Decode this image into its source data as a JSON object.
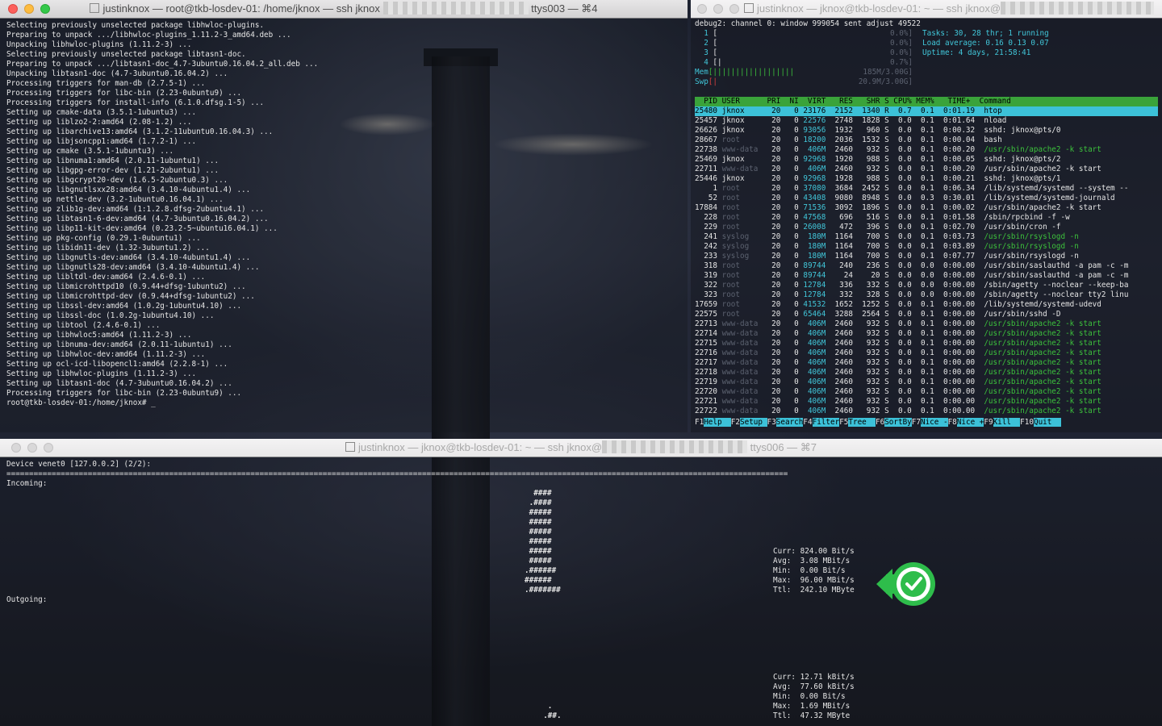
{
  "win1": {
    "title": "justinknox — root@tkb-losdev-01: /home/jknox — ssh jknox",
    "title_tail": "ttys003 — ⌘4",
    "lines": [
      "Selecting previously unselected package libhwloc-plugins.",
      "Preparing to unpack .../libhwloc-plugins_1.11.2-3_amd64.deb ...",
      "Unpacking libhwloc-plugins (1.11.2-3) ...",
      "Selecting previously unselected package libtasn1-doc.",
      "Preparing to unpack .../libtasn1-doc_4.7-3ubuntu0.16.04.2_all.deb ...",
      "Unpacking libtasn1-doc (4.7-3ubuntu0.16.04.2) ...",
      "Processing triggers for man-db (2.7.5-1) ...",
      "Processing triggers for libc-bin (2.23-0ubuntu9) ...",
      "Processing triggers for install-info (6.1.0.dfsg.1-5) ...",
      "Setting up cmake-data (3.5.1-1ubuntu3) ...",
      "Setting up liblzo2-2:amd64 (2.08-1.2) ...",
      "Setting up libarchive13:amd64 (3.1.2-11ubuntu0.16.04.3) ...",
      "Setting up libjsoncpp1:amd64 (1.7.2-1) ...",
      "Setting up cmake (3.5.1-1ubuntu3) ...",
      "Setting up libnuma1:amd64 (2.0.11-1ubuntu1) ...",
      "Setting up libgpg-error-dev (1.21-2ubuntu1) ...",
      "Setting up libgcrypt20-dev (1.6.5-2ubuntu0.3) ...",
      "Setting up libgnutlsxx28:amd64 (3.4.10-4ubuntu1.4) ...",
      "Setting up nettle-dev (3.2-1ubuntu0.16.04.1) ...",
      "Setting up zlib1g-dev:amd64 (1:1.2.8.dfsg-2ubuntu4.1) ...",
      "Setting up libtasn1-6-dev:amd64 (4.7-3ubuntu0.16.04.2) ...",
      "Setting up libp11-kit-dev:amd64 (0.23.2-5~ubuntu16.04.1) ...",
      "Setting up pkg-config (0.29.1-0ubuntu1) ...",
      "Setting up libidn11-dev (1.32-3ubuntu1.2) ...",
      "Setting up libgnutls-dev:amd64 (3.4.10-4ubuntu1.4) ...",
      "Setting up libgnutls28-dev:amd64 (3.4.10-4ubuntu1.4) ...",
      "Setting up libltdl-dev:amd64 (2.4.6-0.1) ...",
      "Setting up libmicrohttpd10 (0.9.44+dfsg-1ubuntu2) ...",
      "Setting up libmicrohttpd-dev (0.9.44+dfsg-1ubuntu2) ...",
      "Setting up libssl-dev:amd64 (1.0.2g-1ubuntu4.10) ...",
      "Setting up libssl-doc (1.0.2g-1ubuntu4.10) ...",
      "Setting up libtool (2.4.6-0.1) ...",
      "Setting up libhwloc5:amd64 (1.11.2-3) ...",
      "Setting up libnuma-dev:amd64 (2.0.11-1ubuntu1) ...",
      "Setting up libhwloc-dev:amd64 (1.11.2-3) ...",
      "Setting up ocl-icd-libopencl1:amd64 (2.2.8-1) ...",
      "Setting up libhwloc-plugins (1.11.2-3) ...",
      "Setting up libtasn1-doc (4.7-3ubuntu0.16.04.2) ...",
      "Processing triggers for libc-bin (2.23-0ubuntu9) ...",
      "root@tkb-losdev-01:/home/jknox# _"
    ]
  },
  "win2": {
    "title": "justinknox — jknox@tkb-losdev-01: ~ — ssh jknox@",
    "debug": "debug2: channel 0: window 999054 sent adjust 49522",
    "meters": [
      {
        "label": "1",
        "bar": "[",
        "val": "0.0%]"
      },
      {
        "label": "2",
        "bar": "[",
        "val": "0.0%]"
      },
      {
        "label": "3",
        "bar": "[",
        "val": "0.0%]"
      },
      {
        "label": "4",
        "bar": "[|",
        "val": "0.7%]"
      },
      {
        "label": "Mem",
        "bar": "[||||||||||||||||||",
        "val": "185M/3.00G]"
      },
      {
        "label": "Swp",
        "bar": "[|",
        "val": "20.9M/3.00G]"
      }
    ],
    "summary": [
      {
        "k": "Tasks: ",
        "v": "30, 28 thr; 1 running"
      },
      {
        "k": "Load average: ",
        "v": "0.16 0.13 0.07"
      },
      {
        "k": "Uptime: ",
        "v": "4 days, 21:58:41"
      }
    ],
    "header": "  PID USER      PRI  NI  VIRT   RES   SHR S CPU% MEM%   TIME+  Command",
    "procs": [
      {
        "pid": "25480",
        "user": "jknox",
        "virt": "23176",
        "res": "2152",
        "shr": "1340",
        "s": "R",
        "cpu": "0.7",
        "mem": "0.1",
        "time": "0:01.19",
        "cmd": "htop",
        "hl": true
      },
      {
        "pid": "25457",
        "user": "jknox",
        "virt": "22576",
        "res": "2748",
        "shr": "1828",
        "s": "S",
        "cpu": "0.0",
        "mem": "0.1",
        "time": "0:01.64",
        "cmd": "nload"
      },
      {
        "pid": "26626",
        "user": "jknox",
        "virt": "93056",
        "res": "1932",
        "shr": "960",
        "s": "S",
        "cpu": "0.0",
        "mem": "0.1",
        "time": "0:00.32",
        "cmd": "sshd: jknox@pts/0"
      },
      {
        "pid": "28667",
        "user": "root",
        "virt": "18200",
        "res": "2036",
        "shr": "1532",
        "s": "S",
        "cpu": "0.0",
        "mem": "0.1",
        "time": "0:00.04",
        "cmd": "bash"
      },
      {
        "pid": "22738",
        "user": "www-data",
        "virt": "406M",
        "res": "2460",
        "shr": "932",
        "s": "S",
        "cpu": "0.0",
        "mem": "0.1",
        "time": "0:00.20",
        "cmd": "/usr/sbin/apache2 -k start",
        "green": true
      },
      {
        "pid": "25469",
        "user": "jknox",
        "virt": "92968",
        "res": "1920",
        "shr": "988",
        "s": "S",
        "cpu": "0.0",
        "mem": "0.1",
        "time": "0:00.05",
        "cmd": "sshd: jknox@pts/2"
      },
      {
        "pid": "22711",
        "user": "www-data",
        "virt": "406M",
        "res": "2460",
        "shr": "932",
        "s": "S",
        "cpu": "0.0",
        "mem": "0.1",
        "time": "0:00.20",
        "cmd": "/usr/sbin/apache2 -k start"
      },
      {
        "pid": "25446",
        "user": "jknox",
        "virt": "92968",
        "res": "1928",
        "shr": "988",
        "s": "S",
        "cpu": "0.0",
        "mem": "0.1",
        "time": "0:00.21",
        "cmd": "sshd: jknox@pts/1"
      },
      {
        "pid": "1",
        "user": "root",
        "virt": "37080",
        "res": "3684",
        "shr": "2452",
        "s": "S",
        "cpu": "0.0",
        "mem": "0.1",
        "time": "0:06.34",
        "cmd": "/lib/systemd/systemd --system --"
      },
      {
        "pid": "52",
        "user": "root",
        "virt": "43408",
        "res": "9080",
        "shr": "8948",
        "s": "S",
        "cpu": "0.0",
        "mem": "0.3",
        "time": "0:30.01",
        "cmd": "/lib/systemd/systemd-journald"
      },
      {
        "pid": "17884",
        "user": "root",
        "virt": "71536",
        "res": "3092",
        "shr": "1896",
        "s": "S",
        "cpu": "0.0",
        "mem": "0.1",
        "time": "0:00.02",
        "cmd": "/usr/sbin/apache2 -k start"
      },
      {
        "pid": "228",
        "user": "root",
        "virt": "47568",
        "res": "696",
        "shr": "516",
        "s": "S",
        "cpu": "0.0",
        "mem": "0.1",
        "time": "0:01.58",
        "cmd": "/sbin/rpcbind -f -w"
      },
      {
        "pid": "229",
        "user": "root",
        "virt": "26008",
        "res": "472",
        "shr": "396",
        "s": "S",
        "cpu": "0.0",
        "mem": "0.1",
        "time": "0:02.70",
        "cmd": "/usr/sbin/cron -f"
      },
      {
        "pid": "241",
        "user": "syslog",
        "virt": "180M",
        "res": "1164",
        "shr": "700",
        "s": "S",
        "cpu": "0.0",
        "mem": "0.1",
        "time": "0:03.73",
        "cmd": "/usr/sbin/rsyslogd -n",
        "green": true
      },
      {
        "pid": "242",
        "user": "syslog",
        "virt": "180M",
        "res": "1164",
        "shr": "700",
        "s": "S",
        "cpu": "0.0",
        "mem": "0.1",
        "time": "0:03.89",
        "cmd": "/usr/sbin/rsyslogd -n",
        "green": true
      },
      {
        "pid": "233",
        "user": "syslog",
        "virt": "180M",
        "res": "1164",
        "shr": "700",
        "s": "S",
        "cpu": "0.0",
        "mem": "0.1",
        "time": "0:07.77",
        "cmd": "/usr/sbin/rsyslogd -n"
      },
      {
        "pid": "318",
        "user": "root",
        "virt": "89744",
        "res": "240",
        "shr": "236",
        "s": "S",
        "cpu": "0.0",
        "mem": "0.0",
        "time": "0:00.00",
        "cmd": "/usr/sbin/saslauthd -a pam -c -m"
      },
      {
        "pid": "319",
        "user": "root",
        "virt": "89744",
        "res": "24",
        "shr": "20",
        "s": "S",
        "cpu": "0.0",
        "mem": "0.0",
        "time": "0:00.00",
        "cmd": "/usr/sbin/saslauthd -a pam -c -m"
      },
      {
        "pid": "322",
        "user": "root",
        "virt": "12784",
        "res": "336",
        "shr": "332",
        "s": "S",
        "cpu": "0.0",
        "mem": "0.0",
        "time": "0:00.00",
        "cmd": "/sbin/agetty --noclear --keep-ba"
      },
      {
        "pid": "323",
        "user": "root",
        "virt": "12784",
        "res": "332",
        "shr": "328",
        "s": "S",
        "cpu": "0.0",
        "mem": "0.0",
        "time": "0:00.00",
        "cmd": "/sbin/agetty --noclear tty2 linu"
      },
      {
        "pid": "17659",
        "user": "root",
        "virt": "41532",
        "res": "1652",
        "shr": "1252",
        "s": "S",
        "cpu": "0.0",
        "mem": "0.1",
        "time": "0:00.00",
        "cmd": "/lib/systemd/systemd-udevd"
      },
      {
        "pid": "22575",
        "user": "root",
        "virt": "65464",
        "res": "3288",
        "shr": "2564",
        "s": "S",
        "cpu": "0.0",
        "mem": "0.1",
        "time": "0:00.00",
        "cmd": "/usr/sbin/sshd -D"
      },
      {
        "pid": "22713",
        "user": "www-data",
        "virt": "406M",
        "res": "2460",
        "shr": "932",
        "s": "S",
        "cpu": "0.0",
        "mem": "0.1",
        "time": "0:00.00",
        "cmd": "/usr/sbin/apache2 -k start",
        "green": true
      },
      {
        "pid": "22714",
        "user": "www-data",
        "virt": "406M",
        "res": "2460",
        "shr": "932",
        "s": "S",
        "cpu": "0.0",
        "mem": "0.1",
        "time": "0:00.00",
        "cmd": "/usr/sbin/apache2 -k start",
        "green": true
      },
      {
        "pid": "22715",
        "user": "www-data",
        "virt": "406M",
        "res": "2460",
        "shr": "932",
        "s": "S",
        "cpu": "0.0",
        "mem": "0.1",
        "time": "0:00.00",
        "cmd": "/usr/sbin/apache2 -k start",
        "green": true
      },
      {
        "pid": "22716",
        "user": "www-data",
        "virt": "406M",
        "res": "2460",
        "shr": "932",
        "s": "S",
        "cpu": "0.0",
        "mem": "0.1",
        "time": "0:00.00",
        "cmd": "/usr/sbin/apache2 -k start",
        "green": true
      },
      {
        "pid": "22717",
        "user": "www-data",
        "virt": "406M",
        "res": "2460",
        "shr": "932",
        "s": "S",
        "cpu": "0.0",
        "mem": "0.1",
        "time": "0:00.00",
        "cmd": "/usr/sbin/apache2 -k start",
        "green": true
      },
      {
        "pid": "22718",
        "user": "www-data",
        "virt": "406M",
        "res": "2460",
        "shr": "932",
        "s": "S",
        "cpu": "0.0",
        "mem": "0.1",
        "time": "0:00.00",
        "cmd": "/usr/sbin/apache2 -k start",
        "green": true
      },
      {
        "pid": "22719",
        "user": "www-data",
        "virt": "406M",
        "res": "2460",
        "shr": "932",
        "s": "S",
        "cpu": "0.0",
        "mem": "0.1",
        "time": "0:00.00",
        "cmd": "/usr/sbin/apache2 -k start",
        "green": true
      },
      {
        "pid": "22720",
        "user": "www-data",
        "virt": "406M",
        "res": "2460",
        "shr": "932",
        "s": "S",
        "cpu": "0.0",
        "mem": "0.1",
        "time": "0:00.00",
        "cmd": "/usr/sbin/apache2 -k start",
        "green": true
      },
      {
        "pid": "22721",
        "user": "www-data",
        "virt": "406M",
        "res": "2460",
        "shr": "932",
        "s": "S",
        "cpu": "0.0",
        "mem": "0.1",
        "time": "0:00.00",
        "cmd": "/usr/sbin/apache2 -k start",
        "green": true
      },
      {
        "pid": "22722",
        "user": "www-data",
        "virt": "406M",
        "res": "2460",
        "shr": "932",
        "s": "S",
        "cpu": "0.0",
        "mem": "0.1",
        "time": "0:00.00",
        "cmd": "/usr/sbin/apache2 -k start",
        "green": true
      }
    ],
    "fkeys": [
      {
        "k": "F1",
        "l": "Help  "
      },
      {
        "k": "F2",
        "l": "Setup "
      },
      {
        "k": "F3",
        "l": "Search"
      },
      {
        "k": "F4",
        "l": "Filter"
      },
      {
        "k": "F5",
        "l": "Tree  "
      },
      {
        "k": "F6",
        "l": "SortBy"
      },
      {
        "k": "F7",
        "l": "Nice -"
      },
      {
        "k": "F8",
        "l": "Nice +"
      },
      {
        "k": "F9",
        "l": "Kill  "
      },
      {
        "k": "F10",
        "l": "Quit  "
      }
    ]
  },
  "win3": {
    "title": "justinknox — jknox@tkb-losdev-01: ~ — ssh jknox@",
    "title_tail": "ttys006 — ⌘7",
    "device": "Device venet0 [127.0.0.2] (2/2):",
    "rule": "=============================================================================================================================================================================",
    "incoming_label": "Incoming:",
    "outgoing_label": "Outgoing:",
    "in_graph": [
      "  ####",
      " .####",
      " #####",
      " #####",
      " #####",
      " #####",
      " #####",
      " #####",
      ".######",
      "######",
      ".#######"
    ],
    "out_graph": [
      "   .",
      "  .##."
    ],
    "in_stats": [
      {
        "k": "Curr:",
        "v": "824.00 Bit/s"
      },
      {
        "k": "Avg: ",
        "v": "3.08 MBit/s"
      },
      {
        "k": "Min: ",
        "v": "0.00 Bit/s"
      },
      {
        "k": "Max: ",
        "v": "96.00 MBit/s"
      },
      {
        "k": "Ttl: ",
        "v": "242.10 MByte"
      }
    ],
    "out_stats": [
      {
        "k": "Curr:",
        "v": "12.71 kBit/s"
      },
      {
        "k": "Avg: ",
        "v": "77.60 kBit/s"
      },
      {
        "k": "Min: ",
        "v": "0.00 Bit/s"
      },
      {
        "k": "Max: ",
        "v": "1.69 MBit/s"
      },
      {
        "k": "Ttl: ",
        "v": "47.32 MByte"
      }
    ]
  }
}
